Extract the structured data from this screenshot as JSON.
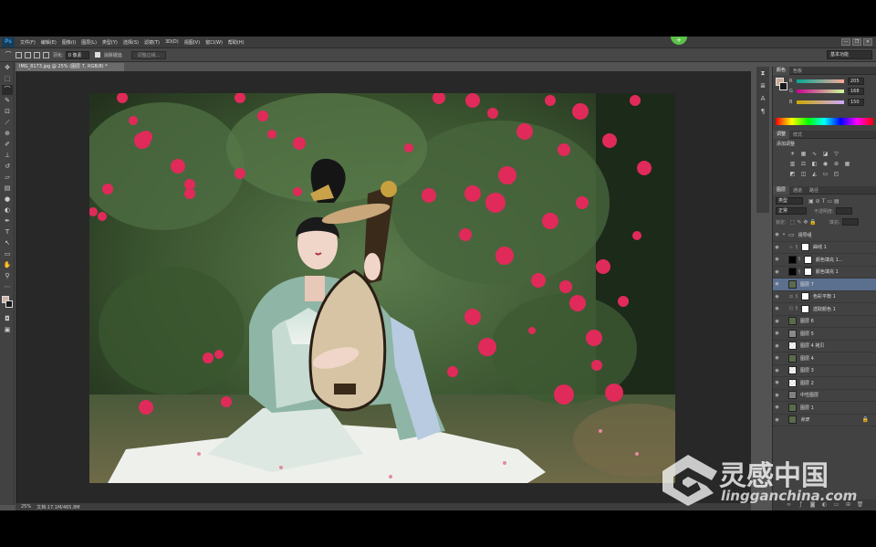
{
  "app": {
    "logo": "Ps",
    "menus": [
      "文件(F)",
      "编辑(E)",
      "图像(I)",
      "图层(L)",
      "类型(Y)",
      "选择(S)",
      "滤镜(T)",
      "3D(D)",
      "视图(V)",
      "窗口(W)",
      "帮助(H)"
    ],
    "window_controls": [
      "—",
      "❐",
      "✕"
    ]
  },
  "options": {
    "feather_label": "羽化:",
    "feather_value": "0 像素",
    "antialias_label": "消除锯齿",
    "refine_edge_label": "调整边缘...",
    "workspace": "基本功能"
  },
  "document": {
    "tab_title": "IMG_8173.jpg @ 25% (图层 7, RGB/8) *",
    "zoom": "25%",
    "doc_size": "文档:17.1M/465.8M"
  },
  "color_panel": {
    "tabs": [
      "颜色",
      "色板"
    ],
    "r": "205",
    "g": "168",
    "b": "150",
    "fg_color": "#cda896",
    "bg_color": "#1a1a1a"
  },
  "adjustments_panel": {
    "tabs": [
      "调整",
      "样式"
    ],
    "title": "添加调整"
  },
  "layers_panel": {
    "tabs": [
      "图层",
      "通道",
      "路径"
    ],
    "kind_filter": "类型",
    "blend_mode": "正常",
    "opacity_label": "不透明度:",
    "lock_label": "锁定:",
    "fill_label": "填充:",
    "layers": [
      {
        "name": "视导组",
        "kind": "group"
      },
      {
        "name": "曲线 1",
        "kind": "adjust"
      },
      {
        "name": "颜色填充 1...",
        "kind": "fill"
      },
      {
        "name": "颜色填充 1",
        "kind": "fill"
      },
      {
        "name": "图层 7",
        "kind": "pixel",
        "selected": true
      },
      {
        "name": "色彩平衡 1",
        "kind": "adjust"
      },
      {
        "name": "选取颜色 1",
        "kind": "adjust"
      },
      {
        "name": "图层 6",
        "kind": "pixel"
      },
      {
        "name": "图层 5",
        "kind": "gray"
      },
      {
        "name": "图层 4 拷贝",
        "kind": "transparent"
      },
      {
        "name": "图层 4",
        "kind": "pixel"
      },
      {
        "name": "图层 3",
        "kind": "transparent"
      },
      {
        "name": "图层 2",
        "kind": "transparent"
      },
      {
        "name": "中性图层",
        "kind": "gray"
      },
      {
        "name": "图层 1",
        "kind": "pixel"
      },
      {
        "name": "背景",
        "kind": "pixel",
        "locked": true
      }
    ]
  },
  "watermark": {
    "cn": "灵感中国",
    "en": "lingganchina.com"
  }
}
